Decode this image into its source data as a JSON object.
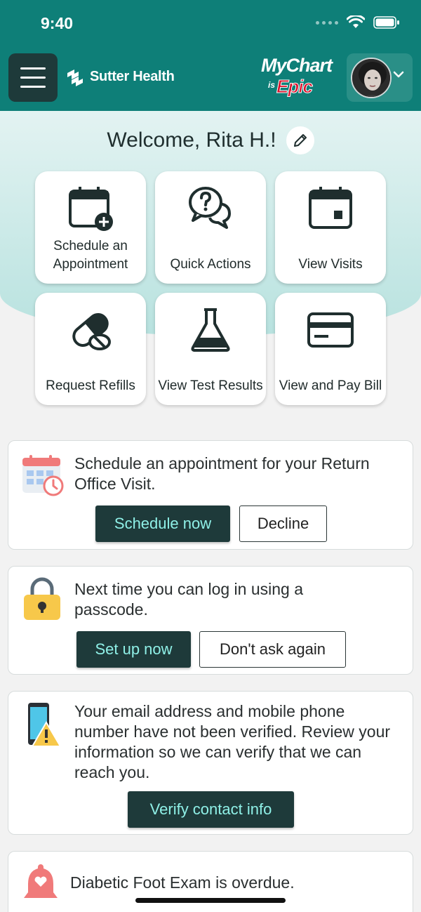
{
  "status": {
    "time": "9:40"
  },
  "header": {
    "brand_name": "Sutter Health",
    "mychart_logo": "MyChart",
    "mychart_is": "is",
    "mychart_epic": "Epic",
    "avatar_alt": "profile photo"
  },
  "welcome": {
    "text": "Welcome, Rita H.!"
  },
  "tiles": [
    {
      "label": "Schedule an Appointment",
      "icon": "calendar-add-icon"
    },
    {
      "label": "Quick Actions",
      "icon": "question-chat-icon"
    },
    {
      "label": "View Visits",
      "icon": "calendar-icon"
    },
    {
      "label": "Request Refills",
      "icon": "pill-icon"
    },
    {
      "label": "View Test Results",
      "icon": "flask-icon"
    },
    {
      "label": "View and Pay Bill",
      "icon": "credit-card-icon"
    }
  ],
  "cards": {
    "appointment": {
      "text": "Schedule an appointment for your Return Office Visit.",
      "primary": "Schedule now",
      "secondary": "Decline"
    },
    "passcode": {
      "text": "Next time you can log in using a passcode.",
      "primary": "Set up now",
      "secondary": "Don't ask again"
    },
    "verify": {
      "text": "Your email address and mobile phone number have not been verified. Review your information so we can verify that we can reach you.",
      "primary": "Verify contact info"
    },
    "foot_exam": {
      "text": "Diabetic Foot Exam is overdue."
    }
  },
  "colors": {
    "header_teal": "#0e7f78",
    "button_dark": "#1e3a3a",
    "button_text": "#8ff0e7",
    "epic_red": "#d9102a"
  }
}
